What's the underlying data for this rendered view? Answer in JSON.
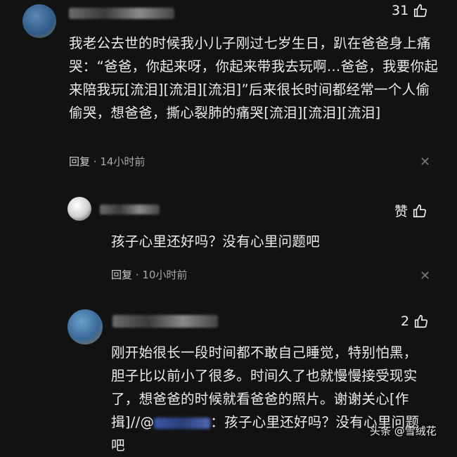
{
  "comments": [
    {
      "likes": "31",
      "text": "我老公去世的时候我小儿子刚过七岁生日，趴在爸爸身上痛哭：“爸爸，你起来呀，你起来带我去玩啊…爸爸，我要你起来陪我玩[流泪][流泪][流泪]”后来很长时间都经常一个人偷偷哭，想爸爸，撕心裂肺的痛哭[流泪][流泪][流泪]",
      "reply_label": "回复",
      "time": "14小时前"
    },
    {
      "likes": "赞",
      "text": "孩子心里还好吗？没有心里问题吧",
      "reply_label": "回复",
      "time": "10小时前"
    },
    {
      "likes": "2",
      "text_before": "刚开始很长一段时间都不敢自己睡觉，特别怕黑，胆子比以前小了很多。时间久了也就慢慢接受现实了，想爸爸的时候就看爸爸的照片。谢谢关心[作揖]//@",
      "text_after": "：孩子心里还好吗？没有心里问题吧"
    }
  ],
  "watermark": "头条 @雪绒花",
  "icons": {
    "like": "thumbs-up-icon",
    "close": "close-icon"
  }
}
